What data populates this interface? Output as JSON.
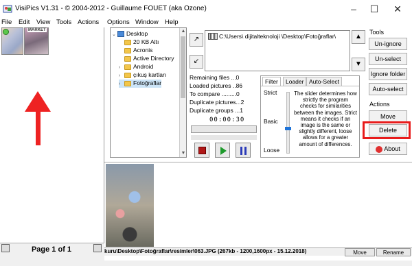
{
  "window": {
    "title": "VisiPics V1.31 - © 2004-2012 - Guillaume FOUET (aka Ozone)",
    "minimize": "–",
    "maximize": "☐",
    "close": "✕"
  },
  "menu": [
    "File",
    "Edit",
    "View",
    "Tools",
    "Actions",
    "Options",
    "Window",
    "Help"
  ],
  "thumbnails": {
    "thumb2_label": "MARKET"
  },
  "tree": {
    "items": [
      {
        "label": "Desktop"
      },
      {
        "label": "20 KB Altı"
      },
      {
        "label": "Acronis"
      },
      {
        "label": "Active Directory"
      },
      {
        "label": "Android"
      },
      {
        "label": "çıkuş kartları"
      },
      {
        "label": "Fotoğraflar"
      }
    ]
  },
  "path": {
    "text": "C:\\Users\\ dijitalteknoloji \\Desktop\\Fotoğraflar\\"
  },
  "stats": {
    "remaining": "Remaining files ...0",
    "loaded": "Loaded pictures ..86",
    "compare": "To compare .........0",
    "dup_pictures": "Duplicate pictures...2",
    "dup_groups": "Duplicate groups ...1",
    "timer": "00:00:30"
  },
  "tabs": {
    "filter": "Filter",
    "loader": "Loader",
    "auto_select": "Auto-Select"
  },
  "filter": {
    "strict": "Strict",
    "basic": "Basic",
    "loose": "Loose",
    "description": "The slider determines how strictly the program checks for similarities between the images. Strict means it checks if an image is the same or slightly different, loose allows for a greater amount of differences."
  },
  "tools": {
    "label": "Tools",
    "unignore": "Un-ignore",
    "unselect": "Un-select",
    "ignore_folder": "Ignore folder",
    "auto_select": "Auto-select"
  },
  "actions": {
    "label": "Actions",
    "move": "Move",
    "delete": "Delete",
    "about": "About"
  },
  "footer": {
    "page_label": "Page 1 of 1"
  },
  "status": {
    "text": "kuru\\Desktop\\Fotoğraflar\\resimler\\063.JPG (267kb - 1200,1600px - 15.12.2018)",
    "move": "Move",
    "rename": "Rename"
  },
  "colors": {
    "highlight": "#e81c1c",
    "arrow": "#ee2222",
    "selection": "#cce4f7"
  }
}
